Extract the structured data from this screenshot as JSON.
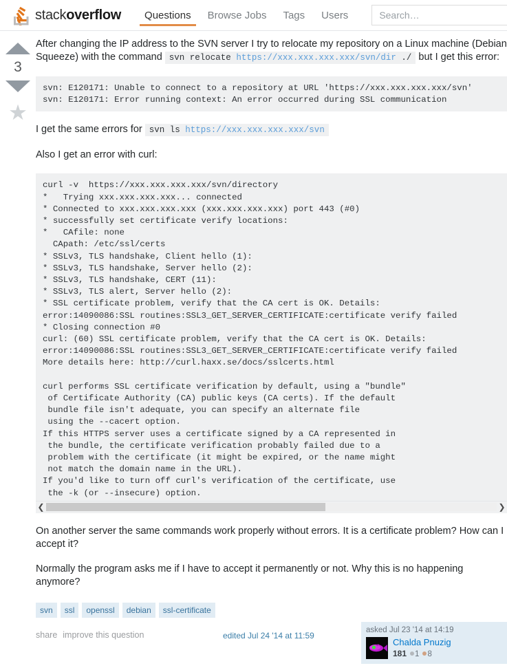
{
  "header": {
    "logo": {
      "text_light": "stack",
      "text_bold": "overflow",
      "icon": "stack-overflow-logo-icon"
    },
    "nav": [
      {
        "label": "Questions",
        "active": true
      },
      {
        "label": "Browse Jobs",
        "active": false
      },
      {
        "label": "Tags",
        "active": false
      },
      {
        "label": "Users",
        "active": false
      }
    ],
    "search": {
      "placeholder": "Search…",
      "value": ""
    }
  },
  "vote": {
    "up_icon": "vote-up-arrow-icon",
    "down_icon": "vote-down-arrow-icon",
    "count": "3",
    "favorite_icon": "star-icon"
  },
  "post": {
    "para1_a": "After changing the IP address to the SVN server I try to relocate my repository on a Linux machine (Debian Squeeze) with the command",
    "para1_code_cmd": "svn relocate ",
    "para1_code_url": "https://xxx.xxx.xxx.xxx/svn/dir",
    "para1_code_tail": " ./",
    "para1_b": "but I get this error:",
    "code1": "svn: E120171: Unable to connect to a repository at URL 'https://xxx.xxx.xxx.xxx/svn'\nsvn: E120171: Error running context: An error occurred during SSL communication",
    "para2_a": "I get the same errors for",
    "para2_code_cmd": "svn ls ",
    "para2_code_url": "https://xxx.xxx.xxx.xxx/svn",
    "para3": "Also I get an error with curl:",
    "code2": "curl -v  https://xxx.xxx.xxx.xxx/svn/directory\n*   Trying xxx.xxx.xxx.xxx... connected\n* Connected to xxx.xxx.xxx.xxx (xxx.xxx.xxx.xxx) port 443 (#0)\n* successfully set certificate verify locations:\n*   CAfile: none\n  CApath: /etc/ssl/certs\n* SSLv3, TLS handshake, Client hello (1):\n* SSLv3, TLS handshake, Server hello (2):\n* SSLv3, TLS handshake, CERT (11):\n* SSLv3, TLS alert, Server hello (2):\n* SSL certificate problem, verify that the CA cert is OK. Details:\nerror:14090086:SSL routines:SSL3_GET_SERVER_CERTIFICATE:certificate verify failed\n* Closing connection #0\ncurl: (60) SSL certificate problem, verify that the CA cert is OK. Details:\nerror:14090086:SSL routines:SSL3_GET_SERVER_CERTIFICATE:certificate verify failed\nMore details here: http://curl.haxx.se/docs/sslcerts.html\n\ncurl performs SSL certificate verification by default, using a \"bundle\"\n of Certificate Authority (CA) public keys (CA certs). If the default\n bundle file isn't adequate, you can specify an alternate file\n using the --cacert option.\nIf this HTTPS server uses a certificate signed by a CA represented in\n the bundle, the certificate verification probably failed due to a\n problem with the certificate (it might be expired, or the name might\n not match the domain name in the URL).\nIf you'd like to turn off curl's verification of the certificate, use\n the -k (or --insecure) option.",
    "scroll_left_icon": "chevron-left-icon",
    "scroll_right_icon": "chevron-right-icon",
    "para4": "On another server the same commands work properly without errors. It is a certificate problem? How can I accept it?",
    "para5": "Normally the program asks me if I have to accept it permanently or not. Why this is no happening anymore?"
  },
  "tags": [
    "svn",
    "ssl",
    "openssl",
    "debian",
    "ssl-certificate"
  ],
  "footer": {
    "share": "share",
    "improve": "improve this question",
    "edited": "edited Jul 24 '14 at 11:59"
  },
  "usercard": {
    "asked": "asked Jul 23 '14 at 14:19",
    "avatar_icon": "user-avatar-fish-image",
    "username": "Chalda Pnuzig",
    "reputation": "181",
    "silver_badges": "1",
    "bronze_badges": "8"
  },
  "colors": {
    "accent_orange": "#e28c47",
    "link_blue": "#0077cc",
    "tag_bg": "#e1ecf4",
    "tag_text": "#39739d",
    "code_bg": "#eff0f1"
  }
}
